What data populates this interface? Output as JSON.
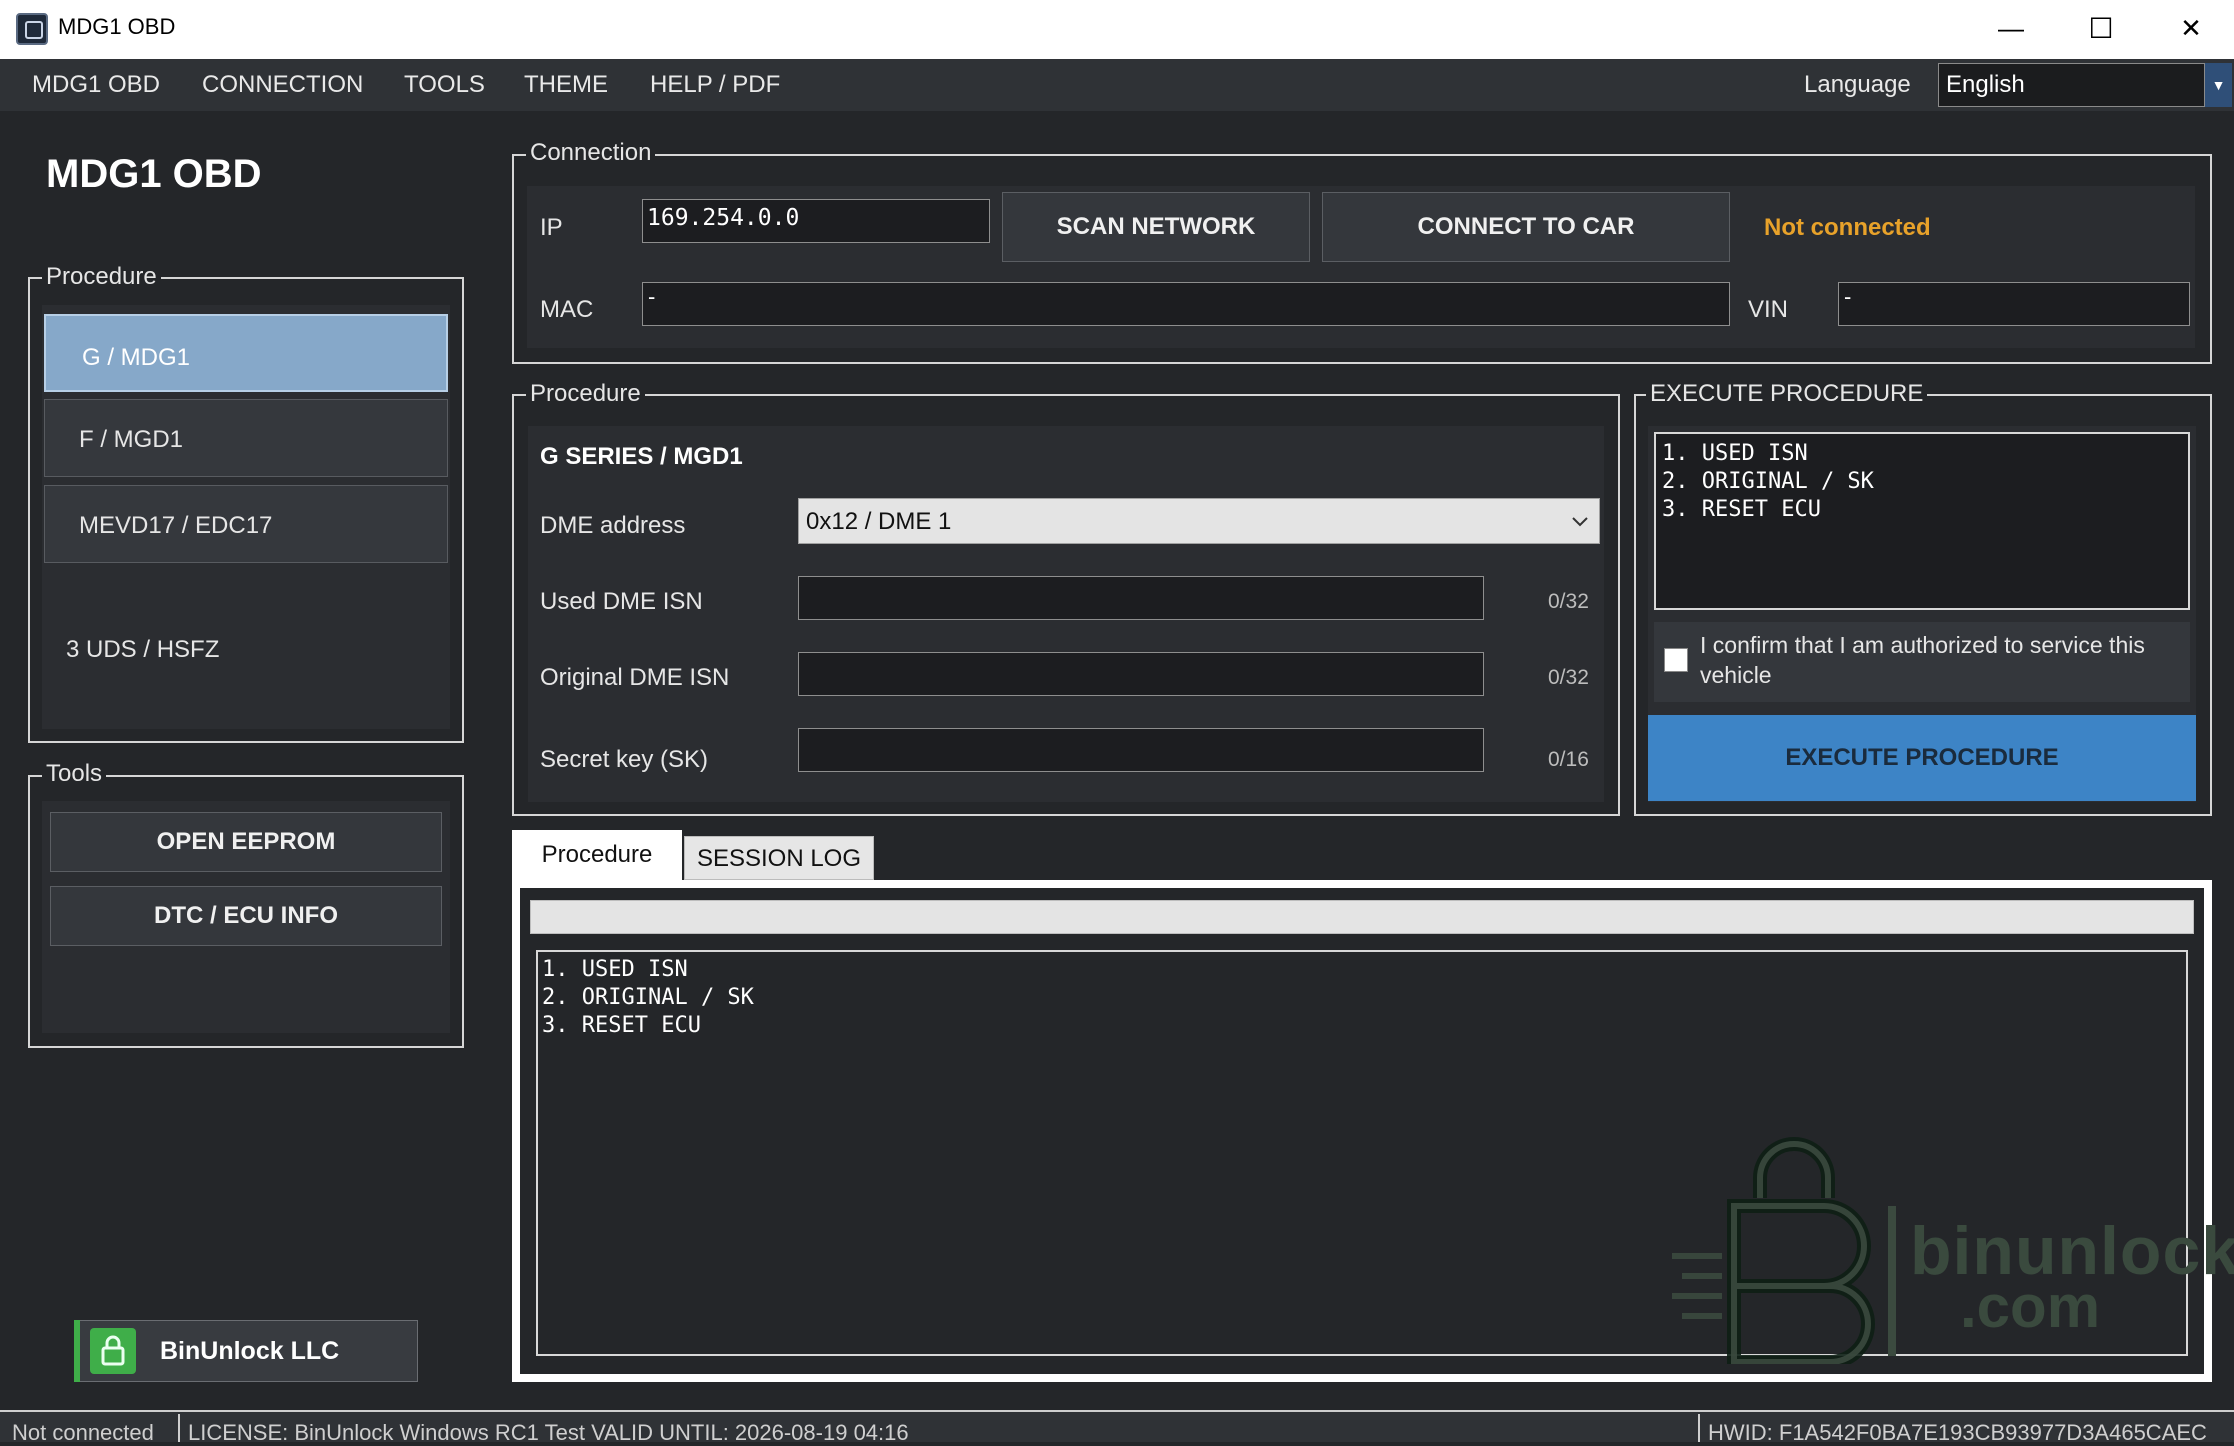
{
  "window": {
    "title": "MDG1 OBD",
    "minimize": "—",
    "maximize": "☐",
    "close": "✕"
  },
  "menu": {
    "items": [
      "MDG1 OBD",
      "CONNECTION",
      "TOOLS",
      "THEME",
      "HELP / PDF"
    ],
    "language_label": "Language",
    "language_value": "English"
  },
  "sidebar": {
    "app_title": "MDG1 OBD",
    "procedure_title": "Procedure",
    "procedures": [
      "G / MDG1",
      "F / MGD1",
      "MEVD17 / EDC17",
      "3 UDS / HSFZ"
    ],
    "tools_title": "Tools",
    "tools": [
      "OPEN EEPROM",
      "DTC / ECU INFO"
    ],
    "brand_label": "BinUnlock LLC"
  },
  "connection": {
    "title": "Connection",
    "ip_label": "IP",
    "ip_value": "169.254.0.0",
    "scan_button": "SCAN NETWORK",
    "connect_button": "CONNECT TO CAR",
    "status": "Not connected",
    "mac_label": "MAC",
    "mac_value": "-",
    "vin_label": "VIN",
    "vin_value": "-"
  },
  "procedure": {
    "title": "Procedure",
    "series": "G SERIES / MGD1",
    "dme_label": "DME address",
    "dme_value": "0x12 / DME 1",
    "used_isn_label": "Used DME ISN",
    "used_isn_count": "0/32",
    "orig_isn_label": "Original DME ISN",
    "orig_isn_count": "0/32",
    "sk_label": "Secret key (SK)",
    "sk_count": "0/16"
  },
  "execute": {
    "title": "EXECUTE PROCEDURE",
    "steps": [
      "1. USED ISN",
      "2. ORIGINAL / SK",
      "3. RESET ECU"
    ],
    "confirm_text": "I confirm that I am authorized to service this vehicle",
    "button": "EXECUTE PROCEDURE"
  },
  "tabs": {
    "items": [
      "Procedure",
      "SESSION LOG"
    ],
    "log_lines": [
      "1. USED ISN",
      "2. ORIGINAL / SK",
      "3. RESET ECU"
    ]
  },
  "watermark": {
    "line1": "binunlock",
    "line2": ".com"
  },
  "status": {
    "connection": "Not connected",
    "license": "LICENSE: BinUnlock Windows RC1 Test   VALID UNTIL: 2026-08-19 04:16",
    "hwid": "HWID: F1A542F0BA7E193CB93977D3A465CAEC"
  },
  "colors": {
    "accent_blue": "#3d84c6",
    "selected_blue": "#86a8c9",
    "warning_orange": "#e8a22a",
    "brand_green": "#3fae49"
  }
}
